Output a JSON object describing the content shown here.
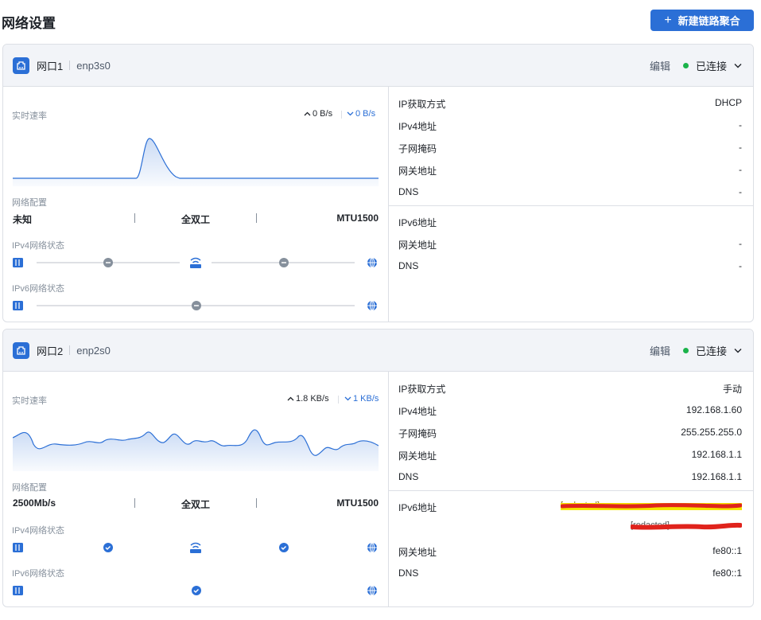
{
  "page": {
    "title": "网络设置",
    "new_button": "新建链路聚合"
  },
  "labels": {
    "realtime_speed": "实时速率",
    "net_config": "网络配置",
    "ipv4_status": "IPv4网络状态",
    "ipv6_status": "IPv6网络状态",
    "edit": "编辑"
  },
  "colors": {
    "accent": "#2b6fd6",
    "connected": "#1bb34a",
    "border": "#dcdfe5",
    "header_bg": "#f2f4f8"
  },
  "ports": [
    {
      "name": "网口1",
      "iface": "enp3s0",
      "status": "已连接",
      "upload": "0 B/s",
      "download": "0 B/s",
      "speed": "未知",
      "duplex": "全双工",
      "mtu": "MTU1500",
      "ipv4_path": "disconnected",
      "ipv6_path": "disconnected",
      "ipv4": [
        {
          "key": "IP获取方式",
          "value": "DHCP"
        },
        {
          "key": "IPv4地址",
          "value": "-"
        },
        {
          "key": "子网掩码",
          "value": "-"
        },
        {
          "key": "网关地址",
          "value": "-"
        },
        {
          "key": "DNS",
          "value": "-"
        }
      ],
      "ipv6": [
        {
          "key": "IPv6地址",
          "value": ""
        },
        {
          "key": "网关地址",
          "value": "-"
        },
        {
          "key": "DNS",
          "value": "-"
        }
      ]
    },
    {
      "name": "网口2",
      "iface": "enp2s0",
      "status": "已连接",
      "upload": "1.8 KB/s",
      "download": "1 KB/s",
      "speed": "2500Mb/s",
      "duplex": "全双工",
      "mtu": "MTU1500",
      "ipv4_path": "connected",
      "ipv6_path": "connected",
      "ipv4": [
        {
          "key": "IP获取方式",
          "value": "手动"
        },
        {
          "key": "IPv4地址",
          "value": "192.168.1.60"
        },
        {
          "key": "子网掩码",
          "value": "255.255.255.0"
        },
        {
          "key": "网关地址",
          "value": "192.168.1.1"
        },
        {
          "key": "DNS",
          "value": "192.168.1.1"
        }
      ],
      "ipv6": [
        {
          "key": "IPv6地址",
          "value": "[redacted]"
        },
        {
          "key": "",
          "value": "[redacted]"
        },
        {
          "key": "网关地址",
          "value": "fe80::1"
        },
        {
          "key": "DNS",
          "value": "fe80::1"
        }
      ]
    }
  ]
}
